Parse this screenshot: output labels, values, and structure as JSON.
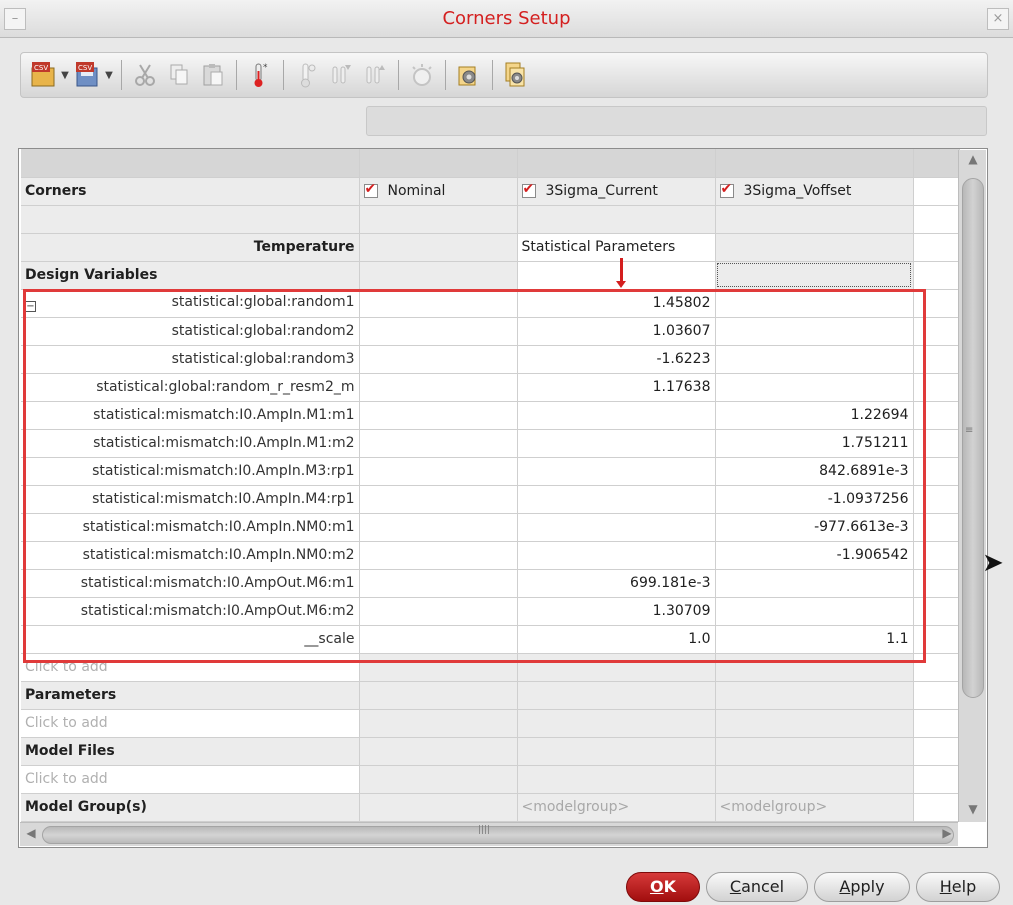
{
  "window": {
    "title": "Corners Setup"
  },
  "toolbar": {
    "icons": [
      "csv-open-icon",
      "csv-save-icon",
      "cut-icon",
      "copy-icon",
      "paste-icon",
      "add-temperature-icon",
      "remove-temperature-icon",
      "import-icon",
      "export-icon",
      "sweep-icon",
      "settings-icon",
      "run-settings-icon"
    ],
    "csv_text": "CSV"
  },
  "table": {
    "corners_label": "Corners",
    "corner_columns": [
      "Nominal",
      "3Sigma_Current",
      "3Sigma_Voffset"
    ],
    "temperature_label": "Temperature",
    "statistical_header": "Statistical Parameters",
    "design_variables_label": "Design Variables",
    "rows": [
      {
        "name": "statistical:global:random1",
        "nominal": "",
        "current": "1.45802",
        "voffset": ""
      },
      {
        "name": "statistical:global:random2",
        "nominal": "",
        "current": "1.03607",
        "voffset": ""
      },
      {
        "name": "statistical:global:random3",
        "nominal": "",
        "current": "-1.6223",
        "voffset": ""
      },
      {
        "name": "statistical:global:random_r_resm2_m",
        "nominal": "",
        "current": "1.17638",
        "voffset": ""
      },
      {
        "name": "statistical:mismatch:I0.AmpIn.M1:m1",
        "nominal": "",
        "current": "",
        "voffset": "1.22694"
      },
      {
        "name": "statistical:mismatch:I0.AmpIn.M1:m2",
        "nominal": "",
        "current": "",
        "voffset": "1.751211"
      },
      {
        "name": "statistical:mismatch:I0.AmpIn.M3:rp1",
        "nominal": "",
        "current": "",
        "voffset": "842.6891e-3"
      },
      {
        "name": "statistical:mismatch:I0.AmpIn.M4:rp1",
        "nominal": "",
        "current": "",
        "voffset": "-1.0937256"
      },
      {
        "name": "statistical:mismatch:I0.AmpIn.NM0:m1",
        "nominal": "",
        "current": "",
        "voffset": "-977.6613e-3"
      },
      {
        "name": "statistical:mismatch:I0.AmpIn.NM0:m2",
        "nominal": "",
        "current": "",
        "voffset": "-1.906542"
      },
      {
        "name": "statistical:mismatch:I0.AmpOut.M6:m1",
        "nominal": "",
        "current": "699.181e-3",
        "voffset": ""
      },
      {
        "name": "statistical:mismatch:I0.AmpOut.M6:m2",
        "nominal": "",
        "current": "1.30709",
        "voffset": ""
      },
      {
        "name": "__scale",
        "nominal": "",
        "current": "1.0",
        "voffset": "1.1"
      }
    ],
    "click_to_add": "Click to add",
    "parameters_label": "Parameters",
    "model_files_label": "Model Files",
    "model_groups_label": "Model Group(s)",
    "model_group_placeholder": "<modelgroup>",
    "tree_toggle": "−"
  },
  "buttons": {
    "ok": "OK",
    "cancel": "Cancel",
    "apply": "Apply",
    "help": "Help"
  },
  "colors": {
    "accent": "#d42020",
    "highlight": "#e03a3a"
  }
}
